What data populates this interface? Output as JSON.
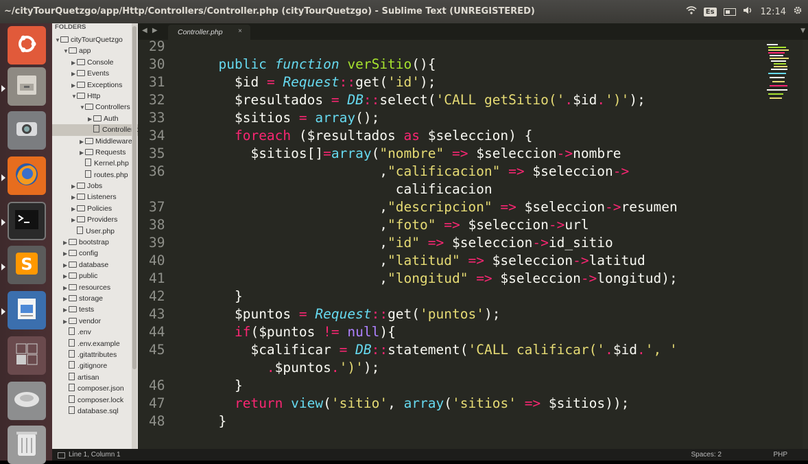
{
  "window": {
    "title": "~/cityTourQuetzgo/app/Http/Controllers/Controller.php (cityTourQuetzgo) - Sublime Text (UNREGISTERED)"
  },
  "tray": {
    "keyboard": "Es",
    "time": "12:14"
  },
  "launcher": {
    "items": [
      {
        "name": "ubuntu-dash",
        "icon": "ubuntu-logo-icon"
      },
      {
        "name": "files",
        "icon": "file-cabinet-icon"
      },
      {
        "name": "scanner",
        "icon": "scanner-icon"
      },
      {
        "name": "firefox",
        "icon": "firefox-icon"
      },
      {
        "name": "terminal",
        "icon": "terminal-icon"
      },
      {
        "name": "sublime-text",
        "icon": "sublime-icon"
      },
      {
        "name": "libreoffice-writer",
        "icon": "writer-icon"
      },
      {
        "name": "workspaces",
        "icon": "workspace-icon"
      },
      {
        "name": "drive",
        "icon": "hard-drive-icon"
      },
      {
        "name": "trash",
        "icon": "trash-icon"
      }
    ]
  },
  "sidebar": {
    "header": "FOLDERS",
    "items": [
      {
        "label": "cityTourQuetzgo",
        "type": "folder",
        "open": true,
        "depth": 0
      },
      {
        "label": "app",
        "type": "folder",
        "open": true,
        "depth": 1
      },
      {
        "label": "Console",
        "type": "folder",
        "open": false,
        "depth": 2
      },
      {
        "label": "Events",
        "type": "folder",
        "open": false,
        "depth": 2
      },
      {
        "label": "Exceptions",
        "type": "folder",
        "open": false,
        "depth": 2
      },
      {
        "label": "Http",
        "type": "folder",
        "open": true,
        "depth": 2
      },
      {
        "label": "Controllers",
        "type": "folder",
        "open": true,
        "depth": 3
      },
      {
        "label": "Auth",
        "type": "folder",
        "open": false,
        "depth": 4
      },
      {
        "label": "Controller.php",
        "type": "file",
        "depth": 4,
        "selected": true
      },
      {
        "label": "Middleware",
        "type": "folder",
        "open": false,
        "depth": 3
      },
      {
        "label": "Requests",
        "type": "folder",
        "open": false,
        "depth": 3
      },
      {
        "label": "Kernel.php",
        "type": "file",
        "depth": 3
      },
      {
        "label": "routes.php",
        "type": "file",
        "depth": 3
      },
      {
        "label": "Jobs",
        "type": "folder",
        "open": false,
        "depth": 2
      },
      {
        "label": "Listeners",
        "type": "folder",
        "open": false,
        "depth": 2
      },
      {
        "label": "Policies",
        "type": "folder",
        "open": false,
        "depth": 2
      },
      {
        "label": "Providers",
        "type": "folder",
        "open": false,
        "depth": 2
      },
      {
        "label": "User.php",
        "type": "file",
        "depth": 2
      },
      {
        "label": "bootstrap",
        "type": "folder",
        "open": false,
        "depth": 1
      },
      {
        "label": "config",
        "type": "folder",
        "open": false,
        "depth": 1
      },
      {
        "label": "database",
        "type": "folder",
        "open": false,
        "depth": 1
      },
      {
        "label": "public",
        "type": "folder",
        "open": false,
        "depth": 1
      },
      {
        "label": "resources",
        "type": "folder",
        "open": false,
        "depth": 1
      },
      {
        "label": "storage",
        "type": "folder",
        "open": false,
        "depth": 1
      },
      {
        "label": "tests",
        "type": "folder",
        "open": false,
        "depth": 1
      },
      {
        "label": "vendor",
        "type": "folder",
        "open": false,
        "depth": 1
      },
      {
        "label": ".env",
        "type": "file",
        "depth": 1
      },
      {
        "label": ".env.example",
        "type": "file",
        "depth": 1
      },
      {
        "label": ".gitattributes",
        "type": "file",
        "depth": 1
      },
      {
        "label": ".gitignore",
        "type": "file",
        "depth": 1
      },
      {
        "label": "artisan",
        "type": "file",
        "depth": 1
      },
      {
        "label": "composer.json",
        "type": "file",
        "depth": 1
      },
      {
        "label": "composer.lock",
        "type": "file",
        "depth": 1
      },
      {
        "label": "database.sql",
        "type": "file",
        "depth": 1
      }
    ]
  },
  "tabs": [
    {
      "label": "Controller.php",
      "close": "×"
    }
  ],
  "editor": {
    "lines": [
      {
        "n": "29",
        "indent": "",
        "tokens": []
      },
      {
        "n": "30",
        "indent": "  ",
        "tokens": [
          {
            "t": "public",
            "c": "c2"
          },
          {
            "t": " "
          },
          {
            "t": "function",
            "c": "c"
          },
          {
            "t": " "
          },
          {
            "t": "verSitio",
            "c": "f"
          },
          {
            "t": "(){"
          }
        ]
      },
      {
        "n": "31",
        "indent": "    ",
        "tokens": [
          {
            "t": "$id "
          },
          {
            "t": "=",
            "c": "k"
          },
          {
            "t": " "
          },
          {
            "t": "Request",
            "c": "c"
          },
          {
            "t": "::",
            "c": "k"
          },
          {
            "t": "get("
          },
          {
            "t": "'id'",
            "c": "s"
          },
          {
            "t": ");"
          }
        ]
      },
      {
        "n": "32",
        "indent": "    ",
        "tokens": [
          {
            "t": "$resultados "
          },
          {
            "t": "=",
            "c": "k"
          },
          {
            "t": " "
          },
          {
            "t": "DB",
            "c": "c"
          },
          {
            "t": "::",
            "c": "k"
          },
          {
            "t": "select("
          },
          {
            "t": "'CALL getSitio('",
            "c": "s"
          },
          {
            "t": ".",
            "c": "k"
          },
          {
            "t": "$id"
          },
          {
            "t": ".",
            "c": "k"
          },
          {
            "t": "')'",
            "c": "s"
          },
          {
            "t": ");"
          }
        ]
      },
      {
        "n": "33",
        "indent": "    ",
        "tokens": [
          {
            "t": "$sitios "
          },
          {
            "t": "=",
            "c": "k"
          },
          {
            "t": " "
          },
          {
            "t": "array",
            "c": "c2"
          },
          {
            "t": "();"
          }
        ]
      },
      {
        "n": "34",
        "indent": "    ",
        "tokens": [
          {
            "t": "foreach",
            "c": "k"
          },
          {
            "t": " ($resultados "
          },
          {
            "t": "as",
            "c": "k"
          },
          {
            "t": " $seleccion) {"
          }
        ]
      },
      {
        "n": "35",
        "indent": "      ",
        "tokens": [
          {
            "t": "$sitios[]"
          },
          {
            "t": "=",
            "c": "k"
          },
          {
            "t": "array",
            "c": "c2"
          },
          {
            "t": "("
          },
          {
            "t": "\"nombre\"",
            "c": "s"
          },
          {
            "t": " "
          },
          {
            "t": "=>",
            "c": "k"
          },
          {
            "t": " $seleccion"
          },
          {
            "t": "->",
            "c": "k"
          },
          {
            "t": "nombre"
          }
        ]
      },
      {
        "n": "36",
        "indent": "                      ",
        "tokens": [
          {
            "t": ","
          },
          {
            "t": "\"calificacion\"",
            "c": "s"
          },
          {
            "t": " "
          },
          {
            "t": "=>",
            "c": "k"
          },
          {
            "t": " $seleccion"
          },
          {
            "t": "->",
            "c": "k"
          }
        ]
      },
      {
        "n": "",
        "indent": "                        ",
        "tokens": [
          {
            "t": "calificacion"
          }
        ]
      },
      {
        "n": "37",
        "indent": "                      ",
        "tokens": [
          {
            "t": ","
          },
          {
            "t": "\"descripcion\"",
            "c": "s"
          },
          {
            "t": " "
          },
          {
            "t": "=>",
            "c": "k"
          },
          {
            "t": " $seleccion"
          },
          {
            "t": "->",
            "c": "k"
          },
          {
            "t": "resumen"
          }
        ]
      },
      {
        "n": "38",
        "indent": "                      ",
        "tokens": [
          {
            "t": ","
          },
          {
            "t": "\"foto\"",
            "c": "s"
          },
          {
            "t": " "
          },
          {
            "t": "=>",
            "c": "k"
          },
          {
            "t": " $seleccion"
          },
          {
            "t": "->",
            "c": "k"
          },
          {
            "t": "url"
          }
        ]
      },
      {
        "n": "39",
        "indent": "                      ",
        "tokens": [
          {
            "t": ","
          },
          {
            "t": "\"id\"",
            "c": "s"
          },
          {
            "t": " "
          },
          {
            "t": "=>",
            "c": "k"
          },
          {
            "t": " $seleccion"
          },
          {
            "t": "->",
            "c": "k"
          },
          {
            "t": "id_sitio"
          }
        ]
      },
      {
        "n": "40",
        "indent": "                      ",
        "tokens": [
          {
            "t": ","
          },
          {
            "t": "\"latitud\"",
            "c": "s"
          },
          {
            "t": " "
          },
          {
            "t": "=>",
            "c": "k"
          },
          {
            "t": " $seleccion"
          },
          {
            "t": "->",
            "c": "k"
          },
          {
            "t": "latitud"
          }
        ]
      },
      {
        "n": "41",
        "indent": "                      ",
        "tokens": [
          {
            "t": ","
          },
          {
            "t": "\"longitud\"",
            "c": "s"
          },
          {
            "t": " "
          },
          {
            "t": "=>",
            "c": "k"
          },
          {
            "t": " $seleccion"
          },
          {
            "t": "->",
            "c": "k"
          },
          {
            "t": "longitud);"
          }
        ]
      },
      {
        "n": "42",
        "indent": "    ",
        "tokens": [
          {
            "t": "}"
          }
        ]
      },
      {
        "n": "43",
        "indent": "    ",
        "tokens": [
          {
            "t": "$puntos "
          },
          {
            "t": "=",
            "c": "k"
          },
          {
            "t": " "
          },
          {
            "t": "Request",
            "c": "c"
          },
          {
            "t": "::",
            "c": "k"
          },
          {
            "t": "get("
          },
          {
            "t": "'puntos'",
            "c": "s"
          },
          {
            "t": ");"
          }
        ]
      },
      {
        "n": "44",
        "indent": "    ",
        "tokens": [
          {
            "t": "if",
            "c": "k"
          },
          {
            "t": "($puntos "
          },
          {
            "t": "!=",
            "c": "k"
          },
          {
            "t": " "
          },
          {
            "t": "null",
            "c": "p"
          },
          {
            "t": "){"
          }
        ]
      },
      {
        "n": "45",
        "indent": "      ",
        "tokens": [
          {
            "t": "$calificar "
          },
          {
            "t": "=",
            "c": "k"
          },
          {
            "t": " "
          },
          {
            "t": "DB",
            "c": "c"
          },
          {
            "t": "::",
            "c": "k"
          },
          {
            "t": "statement("
          },
          {
            "t": "'CALL calificar('",
            "c": "s"
          },
          {
            "t": ".",
            "c": "k"
          },
          {
            "t": "$id"
          },
          {
            "t": ".",
            "c": "k"
          },
          {
            "t": "', '",
            "c": "s"
          }
        ]
      },
      {
        "n": "",
        "indent": "        ",
        "tokens": [
          {
            "t": ".",
            "c": "k"
          },
          {
            "t": "$puntos"
          },
          {
            "t": ".",
            "c": "k"
          },
          {
            "t": "')'",
            "c": "s"
          },
          {
            "t": ");"
          }
        ]
      },
      {
        "n": "46",
        "indent": "    ",
        "tokens": [
          {
            "t": "}"
          }
        ]
      },
      {
        "n": "47",
        "indent": "    ",
        "tokens": [
          {
            "t": "return",
            "c": "k"
          },
          {
            "t": " "
          },
          {
            "t": "view",
            "c": "c2"
          },
          {
            "t": "("
          },
          {
            "t": "'sitio'",
            "c": "s"
          },
          {
            "t": ", "
          },
          {
            "t": "array",
            "c": "c2"
          },
          {
            "t": "("
          },
          {
            "t": "'sitios'",
            "c": "s"
          },
          {
            "t": " "
          },
          {
            "t": "=>",
            "c": "k"
          },
          {
            "t": " $sitios));"
          }
        ]
      },
      {
        "n": "48",
        "indent": "  ",
        "tokens": [
          {
            "t": "}"
          }
        ]
      }
    ]
  },
  "statusbar": {
    "position": "Line 1, Column 1",
    "spaces": "Spaces: 2",
    "syntax": "PHP"
  },
  "colors": {
    "background": "#272822",
    "keyword": "#f92672",
    "string": "#e6db74",
    "function": "#a6e22e",
    "type": "#66d9ef",
    "purple": "#ae81ff"
  }
}
